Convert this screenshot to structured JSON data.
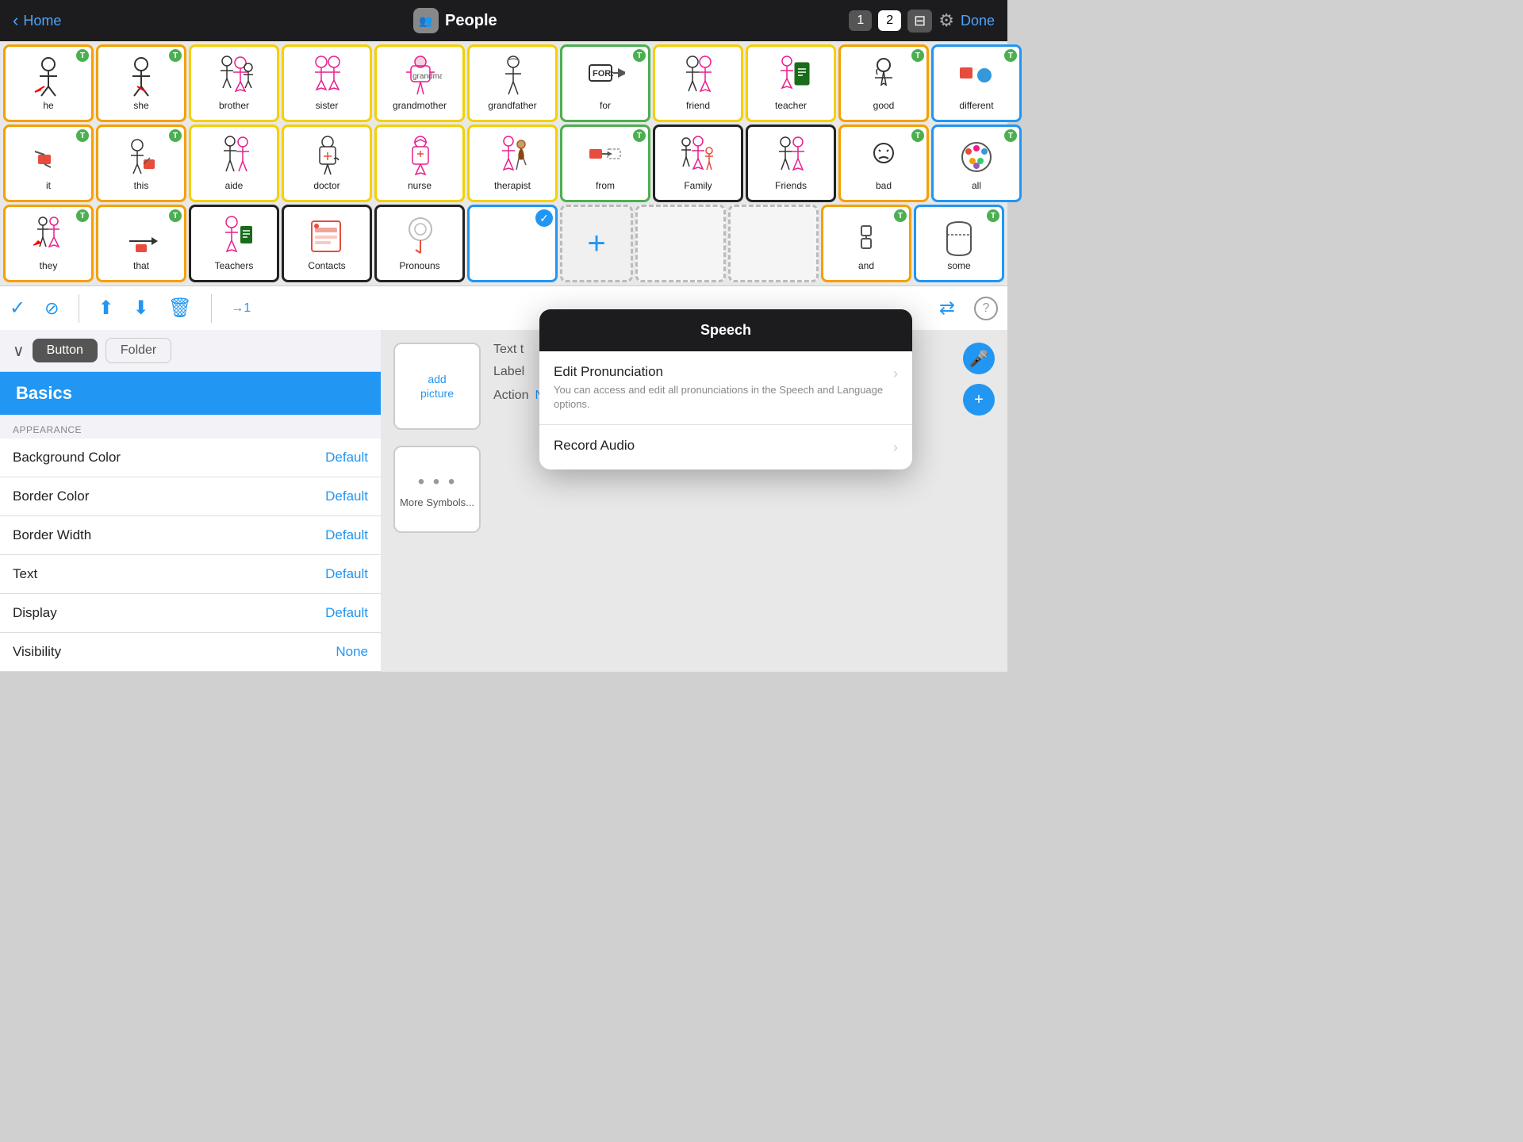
{
  "nav": {
    "back_label": "Home",
    "title": "People",
    "page1": "1",
    "page2": "2",
    "done_label": "Done"
  },
  "grid": {
    "rows": [
      [
        {
          "label": "he",
          "border": "orange",
          "badge": "T"
        },
        {
          "label": "she",
          "border": "orange",
          "badge": "T"
        },
        {
          "label": "brother",
          "border": "yellow"
        },
        {
          "label": "sister",
          "border": "yellow"
        },
        {
          "label": "grandmother",
          "border": "yellow"
        },
        {
          "label": "grandfather",
          "border": "yellow"
        },
        {
          "label": "for",
          "border": "green",
          "badge": "T"
        },
        {
          "label": "friend",
          "border": "yellow"
        },
        {
          "label": "teacher",
          "border": "yellow"
        },
        {
          "label": "good",
          "border": "orange",
          "badge": "T"
        },
        {
          "label": "different",
          "border": "blue",
          "badge": "T"
        }
      ],
      [
        {
          "label": "it",
          "border": "orange",
          "badge": "T"
        },
        {
          "label": "this",
          "border": "orange",
          "badge": "T"
        },
        {
          "label": "aide",
          "border": "yellow"
        },
        {
          "label": "doctor",
          "border": "yellow"
        },
        {
          "label": "nurse",
          "border": "yellow"
        },
        {
          "label": "therapist",
          "border": "yellow"
        },
        {
          "label": "from",
          "border": "green",
          "badge": "T"
        },
        {
          "label": "Family",
          "border": "black"
        },
        {
          "label": "Friends",
          "border": "black"
        },
        {
          "label": "bad",
          "border": "orange",
          "badge": "T"
        },
        {
          "label": "all",
          "border": "blue",
          "badge": "T"
        }
      ],
      [
        {
          "label": "they",
          "border": "orange",
          "badge": "T"
        },
        {
          "label": "that",
          "border": "orange",
          "badge": "T"
        },
        {
          "label": "Teachers",
          "border": "black"
        },
        {
          "label": "Contacts",
          "border": "black"
        },
        {
          "label": "Pronouns",
          "border": "black",
          "selected": true
        },
        {
          "label": "",
          "border": "blue",
          "checkmark": true
        },
        {
          "label": "+",
          "type": "plus"
        },
        {
          "label": "",
          "type": "empty-dashed"
        },
        {
          "label": "",
          "type": "empty-dashed"
        },
        {
          "label": "and",
          "border": "orange",
          "badge": "T"
        },
        {
          "label": "some",
          "border": "blue",
          "badge": "T"
        }
      ]
    ]
  },
  "toolbar": {
    "check_icon": "✓",
    "no_icon": "🚫",
    "import_icon": "⬆",
    "copy_icon": "⬇",
    "trash_icon": "🗑",
    "jump_label": "→1",
    "swap_icon": "⇄",
    "help_icon": "?"
  },
  "left_panel": {
    "dropdown_icon": "∨",
    "button_label": "Button",
    "folder_label": "Folder",
    "selected_item": "Basics",
    "appearance_label": "APPEARANCE",
    "settings": [
      {
        "label": "Background Color",
        "value": "Default"
      },
      {
        "label": "Border Color",
        "value": "Default"
      },
      {
        "label": "Border Width",
        "value": "Default"
      },
      {
        "label": "Text",
        "value": "Default"
      },
      {
        "label": "Display",
        "value": "Default"
      },
      {
        "label": "Visibility",
        "value": "None"
      }
    ]
  },
  "right_panel": {
    "add_picture_line1": "add",
    "add_picture_line2": "picture",
    "text_label": "Text t",
    "label_label": "Label",
    "action_label": "Action",
    "none_label": "None",
    "more_symbols_dots": "• • •",
    "more_symbols_label": "More Symbols..."
  },
  "speech_modal": {
    "title": "Speech",
    "items": [
      {
        "title": "Edit Pronunciation",
        "description": "You can access and edit all pronunciations in the Speech and Language options.",
        "has_chevron": true
      },
      {
        "title": "Record Audio",
        "description": "",
        "has_chevron": true
      }
    ]
  }
}
